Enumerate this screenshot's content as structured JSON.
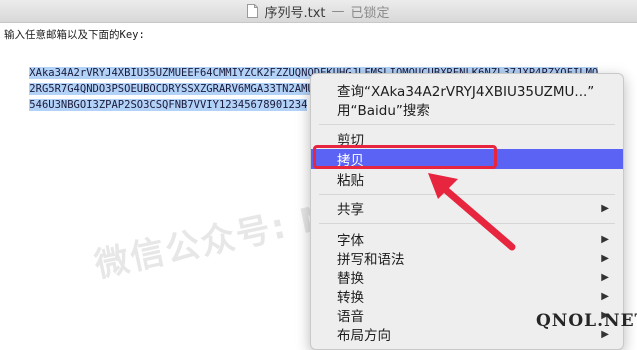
{
  "window": {
    "filename": "序列号.txt",
    "separator": "—",
    "status": "已锁定"
  },
  "editor": {
    "prompt": "输入任意邮箱以及下面的Key:",
    "key_lines": [
      "XAka34A2rVRYJ4XBIU35UZMUEEF64CMMIYZCK2FZZUQNODEKUHGJLFMSLIQMQUCUBXRENLK6NZL37JXP4PZXQFILMQ",
      "2RG5R7G4QNDO3PSOEUBOCDRYSSXZGRARV6MGA33TN2AMUBHEL4FXMWYTTJDEINJXUAV4BAYKBDCZQWVF3LWYXSDCXY",
      "546U3NBGOI3ZPAP2SO3CSQFNB7VVIY12345678901234"
    ]
  },
  "watermark": "微信公众号: Mac软件管家",
  "context_menu": {
    "items": [
      {
        "label": "查询“XAka34A2rVRYJ4XBIU35UZMU...”",
        "arrow": false
      },
      {
        "label": "用“Baidu”搜索",
        "arrow": false
      },
      {
        "label": "剪切",
        "arrow": false
      },
      {
        "label": "拷贝",
        "arrow": false,
        "active": true
      },
      {
        "label": "粘贴",
        "arrow": false
      },
      {
        "label": "共享",
        "arrow": true
      },
      {
        "label": "字体",
        "arrow": true
      },
      {
        "label": "拼写和语法",
        "arrow": true
      },
      {
        "label": "替换",
        "arrow": true
      },
      {
        "label": "转换",
        "arrow": true
      },
      {
        "label": "语音",
        "arrow": true
      },
      {
        "label": "布局方向",
        "arrow": true
      }
    ],
    "arrow_glyph": "▶"
  },
  "annotation": {
    "highlight_color": "#e8253e",
    "site_label": "QNOL.NET"
  }
}
